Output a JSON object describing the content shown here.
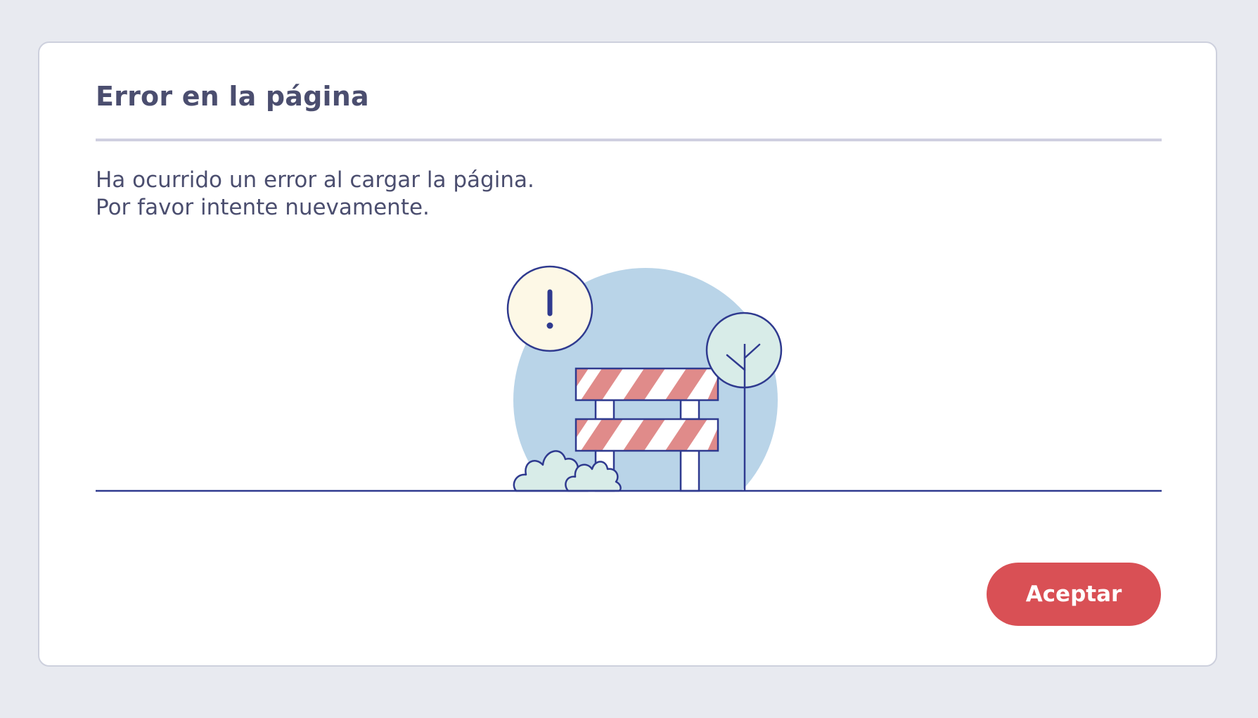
{
  "dialog": {
    "title": "Error en la página",
    "message_line1": "Ha ocurrido un error al cargar la página.",
    "message_line2": "Por favor intente nuevamente.",
    "accept_label": "Aceptar"
  },
  "illustration": {
    "warning_glyph": "!",
    "icons": [
      "warning-icon",
      "road-barrier-icon",
      "tree-icon",
      "bush-icon"
    ]
  },
  "colors": {
    "page_background": "#e8eaf0",
    "dialog_background": "#ffffff",
    "text": "#4b4e6f",
    "divider": "#cfcfe0",
    "accent_button": "#d95055",
    "illustration_outline": "#2f3a8f",
    "illustration_sky": "#b9d4e8",
    "barrier_stripe": "#e08b8a",
    "foliage": "#d8ece8",
    "warning_bubble": "#fdf8e6"
  }
}
